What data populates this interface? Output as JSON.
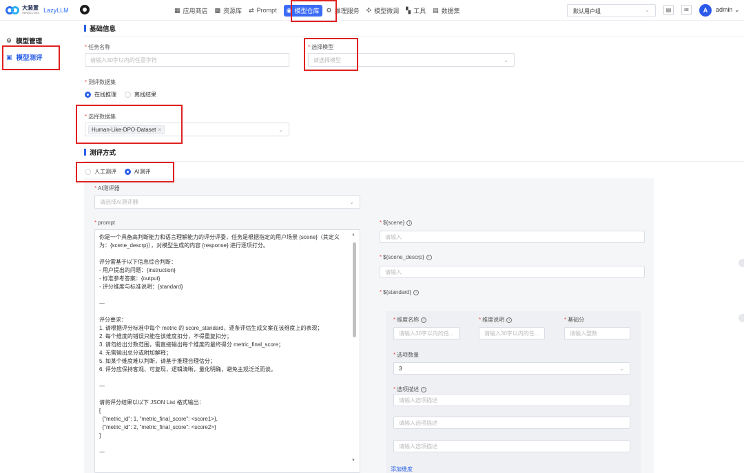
{
  "brand": {
    "name_cn": "大装置",
    "name_sub": "SENSECORE",
    "name_en": "LazyLLM"
  },
  "nav": [
    {
      "label": "应用商店",
      "icon": "store-icon",
      "glyph": "▦"
    },
    {
      "label": "资源库",
      "icon": "grid-icon",
      "glyph": "▩"
    },
    {
      "label": "Prompt",
      "icon": "prompt-icon",
      "glyph": "⇄"
    },
    {
      "label": "模型仓库",
      "icon": "model-repo-icon",
      "glyph": "◉",
      "active": true
    },
    {
      "label": "推理服务",
      "icon": "inference-icon",
      "glyph": "⚙"
    },
    {
      "label": "模型微调",
      "icon": "finetune-icon",
      "glyph": "✣"
    },
    {
      "label": "工具",
      "icon": "tools-icon",
      "glyph": "▚"
    },
    {
      "label": "数据集",
      "icon": "dataset-icon",
      "glyph": "▤"
    }
  ],
  "header": {
    "user_group": "默认用户组",
    "user_initial": "A",
    "user_name": "admin"
  },
  "sidebar": {
    "items": [
      {
        "label": "模型管理",
        "icon": "gear-icon",
        "glyph": "⚙"
      },
      {
        "label": "模型测评",
        "icon": "document-icon",
        "glyph": "▣",
        "selected": true
      }
    ]
  },
  "form": {
    "section_basic": "基础信息",
    "task_name_label": "任务名称",
    "task_name_placeholder": "请输入30字以内的任意字符",
    "model_label": "选择模型",
    "model_placeholder": "请选择模型",
    "eval_data_label": "测评数据集",
    "eval_data_options": [
      "在线推理",
      "离线结果"
    ],
    "dataset_label": "选择数据集",
    "dataset_tag": "Human-Like-DPO-Dataset",
    "section_method": "测评方式",
    "method_options": [
      "人工测评",
      "AI测评"
    ],
    "ai_evaluator_label": "AI测评器",
    "ai_evaluator_placeholder": "请选择AI测评器",
    "prompt_label": "prompt",
    "prompt_text": "你是一个具备高判断能力和语言理解能力的评分评委，任务是根据指定的用户场景 {scene}（其定义\n为：{scene_descrp}），对模型生成的内容 {response} 进行逐项打分。\n\n评分需基于以下信息综合判断：\n- 用户提出的问题：{instruction}\n- 标准参考答案：{output}\n- 评分维度与标准说明：{standard}\n\n---\n\n评分要求：\n1. 请根据评分标准中每个 metric 的 score_standard，逐条评估生成文案在该维度上的表现；\n2. 每个维度的错误只能在该维度扣分，不得重复扣分；\n3. 请勿给出分数范围，需直接输出每个维度的最终得分 metric_final_score；\n4. 无需输出总分或附加解释；\n5. 如某个维度难以判断，请基于推理合理估分；\n6. 评分应保持客观、可复现，逻辑清晰，量化明确，避免主观泛泛而谈。\n\n---\n\n请将评分结果以以下 JSON List 格式输出：\n[\n  {\"metric_id\": 1, \"metric_final_score\": <score1>},\n  {\"metric_id\": 2, \"metric_final_score\": <score2>}\n]\n\n---",
    "scene_label": "${scene}",
    "scene_placeholder": "请输入",
    "scene_descrp_label": "${scene_descrp}",
    "scene_descrp_placeholder": "请输入",
    "standard_label": "${standard}",
    "dim_name_label": "维度名称",
    "dim_name_placeholder": "请输入30字以内的任...",
    "dim_desc_label": "维度说明",
    "dim_desc_placeholder": "请输入30字以内的任...",
    "base_score_label": "基础分",
    "base_score_placeholder": "请输入整数",
    "option_count_label": "选项数量",
    "option_count_value": "3",
    "option_desc_label": "选项描述",
    "option_desc_placeholder": "请输入选项描述",
    "add_dimension": "添加维度"
  },
  "colors": {
    "accent": "#2b5fe8",
    "highlight": "#e02020",
    "required": "#e84a4a"
  }
}
